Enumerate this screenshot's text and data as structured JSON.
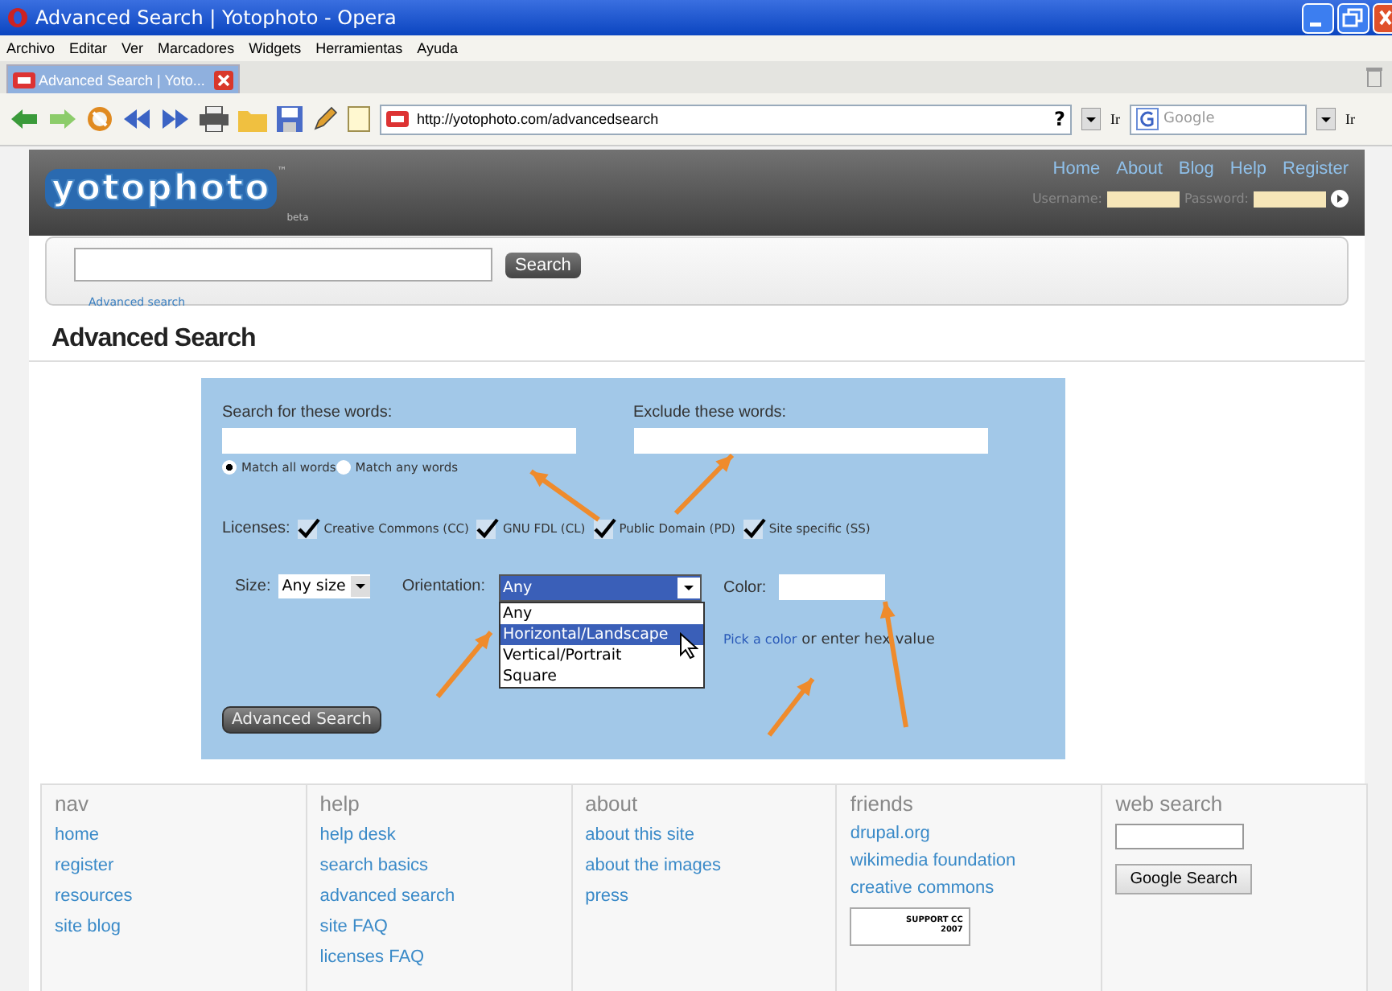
{
  "window": {
    "title": "Advanced Search | Yotophoto - Opera"
  },
  "menu": [
    "Archivo",
    "Editar",
    "Ver",
    "Marcadores",
    "Widgets",
    "Herramientas",
    "Ayuda"
  ],
  "tabs": [
    {
      "label": "Advanced Search | Yoto...",
      "selected": true
    }
  ],
  "toolbar": {
    "address": "http://yotophoto.com/advancedsearch",
    "help": "?",
    "go_label": "Ir",
    "search_placeholder": "Google",
    "search_go_label": "Ir"
  },
  "header": {
    "logo": "yotophoto",
    "trademark": "™",
    "beta": "beta",
    "nav": [
      "Home",
      "About",
      "Blog",
      "Help",
      "Register"
    ],
    "username_label": "Username:",
    "password_label": "Password:"
  },
  "site_search": {
    "button": "Search",
    "link": "Advanced search"
  },
  "heading": "Advanced Search",
  "form": {
    "include_label": "Search for these words:",
    "exclude_label": "Exclude these words:",
    "match": [
      {
        "label": "Match all words",
        "selected": true
      },
      {
        "label": "Match any words",
        "selected": false
      }
    ],
    "licenses_label": "Licenses:",
    "licenses": [
      {
        "label": "Creative Commons (CC)",
        "checked": true
      },
      {
        "label": "GNU FDL (CL)",
        "checked": true
      },
      {
        "label": "Public Domain (PD)",
        "checked": true
      },
      {
        "label": "Site specific (SS)",
        "checked": true
      }
    ],
    "size_label": "Size:",
    "size_value": "Any size",
    "orientation_label": "Orientation:",
    "orientation_value": "Any",
    "orientation_options": [
      {
        "label": "Any",
        "selected": false
      },
      {
        "label": "Horizontal/Landscape",
        "selected": true
      },
      {
        "label": "Vertical/Portrait",
        "selected": false
      },
      {
        "label": "Square",
        "selected": false
      }
    ],
    "color_label": "Color:",
    "pick_link": "Pick a color",
    "hint": "or enter hex value",
    "submit": "Advanced Search"
  },
  "footer": [
    {
      "heading": "nav",
      "links": [
        "home",
        "register",
        "resources",
        "site blog"
      ]
    },
    {
      "heading": "help",
      "links": [
        "help desk",
        "search basics",
        "advanced search",
        "site FAQ",
        "licenses FAQ"
      ]
    },
    {
      "heading": "about",
      "links": [
        "about this site",
        "about the images",
        "press"
      ]
    },
    {
      "heading": "friends",
      "links": [
        "drupal.org",
        "wikimedia foundation",
        "creative commons"
      ],
      "badge": {
        "line_1": "SUPPORT CC",
        "line_2": "2007"
      }
    },
    {
      "heading": "web search",
      "button": "Google Search"
    }
  ]
}
